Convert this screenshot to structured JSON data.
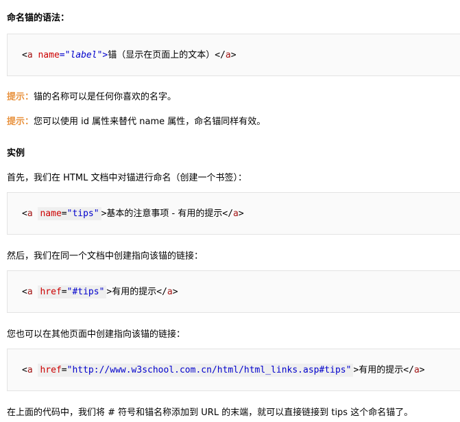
{
  "syntax_heading": "命名锚的语法：",
  "syntax_code": {
    "open_lt": "<",
    "tag": "a",
    "space": " ",
    "attr": "name",
    "eq_quote": "=\"",
    "value": "label",
    "close_quote_gt": "\">",
    "text": "锚（显示在页面上的文本）",
    "end_lt": "</",
    "end_tag": "a",
    "end_gt": ">"
  },
  "tip1": {
    "label": "提示：",
    "text": "锚的名称可以是任何你喜欢的名字。"
  },
  "tip2": {
    "label": "提示：",
    "text": "您可以使用 id 属性来替代 name 属性，命名锚同样有效。"
  },
  "example_heading": "实例",
  "para1": "首先，我们在 HTML 文档中对锚进行命名（创建一个书签）：",
  "code1": {
    "lt": "<",
    "tag": "a",
    "attr": "name",
    "eq": "=",
    "value": "\"tips\"",
    "gt": ">",
    "text": "基本的注意事项 - 有用的提示",
    "end_lt": "</",
    "end_tag": "a",
    "end_gt": ">"
  },
  "para2": "然后，我们在同一个文档中创建指向该锚的链接：",
  "code2": {
    "lt": "<",
    "tag": "a",
    "attr": "href",
    "eq": "=",
    "value": "\"#tips\"",
    "gt": ">",
    "text": "有用的提示",
    "end_lt": "</",
    "end_tag": "a",
    "end_gt": ">"
  },
  "para3": "您也可以在其他页面中创建指向该锚的链接：",
  "code3": {
    "lt": "<",
    "tag": "a",
    "attr": "href",
    "eq": "=",
    "value": "\"http://www.w3school.com.cn/html/html_links.asp#tips\"",
    "gt": ">",
    "text": "有用的提示",
    "end_lt": "</",
    "end_tag": "a",
    "end_gt": ">"
  },
  "para4": "在上面的代码中，我们将 # 符号和锚名称添加到 URL 的末端，就可以直接链接到 tips 这个命名锚了。"
}
